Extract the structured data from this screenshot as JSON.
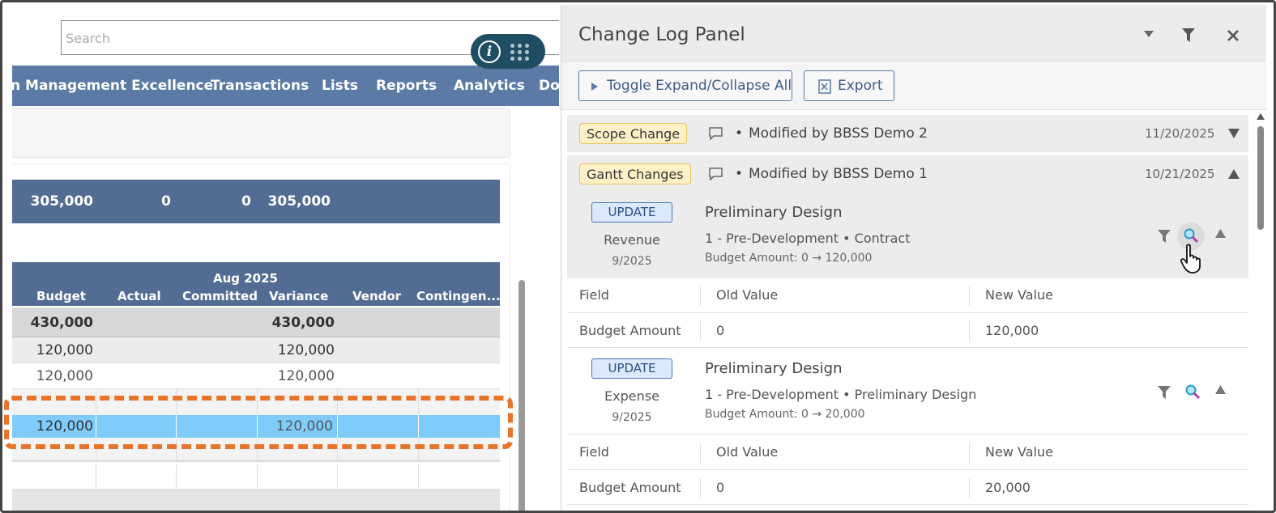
{
  "search": {
    "placeholder": "Search"
  },
  "nav": {
    "items": [
      "n Management Excellence",
      "Transactions",
      "Lists",
      "Reports",
      "Analytics",
      "Doc"
    ]
  },
  "totals": [
    "305,000",
    "0",
    "0",
    "305,000"
  ],
  "table": {
    "period": "Aug 2025",
    "columns": [
      "Budget",
      "Actual",
      "Committed",
      "Variance",
      "Vendor",
      "Contingen..."
    ],
    "rows": [
      {
        "budget": "430,000",
        "variance": "430,000"
      },
      {
        "budget": "120,000",
        "variance": "120,000"
      },
      {
        "budget": "120,000",
        "variance": "120,000"
      },
      {
        "budget": "120,000",
        "variance": "120,000"
      }
    ]
  },
  "panel": {
    "title": "Change Log Panel",
    "toggle_label": "Toggle Expand/Collapse All",
    "export_label": "Export",
    "groups": [
      {
        "tag": "Scope Change",
        "text": "Modified by BBSS Demo 2",
        "date": "11/20/2025"
      },
      {
        "tag": "Gantt Changes",
        "text": "Modified by BBSS Demo 1",
        "date": "10/21/2025"
      }
    ],
    "updates": [
      {
        "badge": "UPDATE",
        "type": "Revenue",
        "period": "9/2025",
        "title": "Preliminary Design",
        "subtitle": "1 - Pre-Development • Contract",
        "change": "Budget Amount: 0 → 120,000",
        "headers": [
          "Field",
          "Old Value",
          "New Value"
        ],
        "field": "Budget Amount",
        "old": "0",
        "new": "120,000"
      },
      {
        "badge": "UPDATE",
        "type": "Expense",
        "period": "9/2025",
        "title": "Preliminary Design",
        "subtitle": "1 - Pre-Development • Preliminary Design",
        "change": "Budget Amount: 0 → 20,000",
        "headers": [
          "Field",
          "Old Value",
          "New Value"
        ],
        "field": "Budget Amount",
        "old": "0",
        "new": "20,000"
      }
    ]
  },
  "colors": {
    "nav": "#5b7aa5",
    "header": "#536c94",
    "highlight_row": "#7fccfb",
    "dash": "#e8742a",
    "tag_bg": "#fff1c7",
    "badge_bg": "#dce8fb"
  },
  "icons": [
    "info-icon",
    "apps-grid-icon",
    "chevron-down-icon",
    "filter-icon",
    "close-icon",
    "play-icon",
    "excel-icon",
    "comment-icon",
    "magnify-icon",
    "collapse-up-icon",
    "hand-cursor-icon"
  ]
}
